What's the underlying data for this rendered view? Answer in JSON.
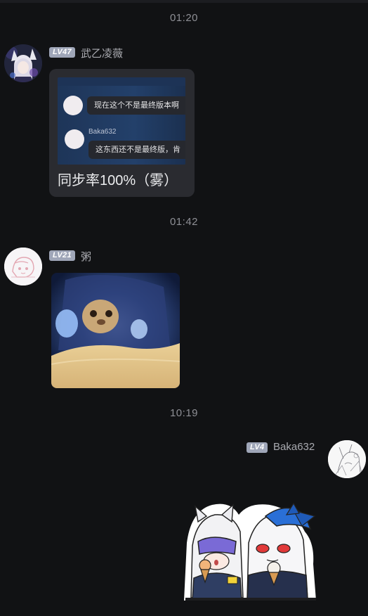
{
  "messages": [
    {
      "time": "01:20",
      "level": "LV47",
      "sender": "武乙凌薇",
      "quote": {
        "line1": "现在这个不是最终版本啊",
        "nick": "Baka632",
        "line2": "这东西还不是最终版，肯"
      },
      "text": "同步率100%（雾）"
    },
    {
      "time": "01:42",
      "level": "LV21",
      "sender": "粥",
      "image": "animated-meme-image"
    },
    {
      "time": "10:19",
      "level": "LV4",
      "sender": "Baka632",
      "sticker": "anime-chibi-sticker"
    }
  ],
  "colors": {
    "background": "#111214",
    "bubble": "#2a2b30",
    "badge": "#9fa6b8",
    "time_text": "#8e8f95",
    "name_text": "#a9aab0"
  }
}
